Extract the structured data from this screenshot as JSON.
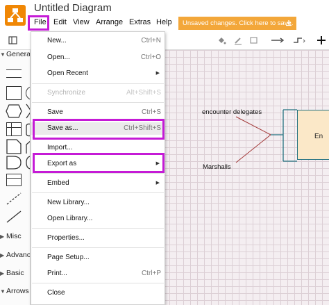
{
  "header": {
    "title": "Untitled Diagram",
    "menu": [
      "File",
      "Edit",
      "View",
      "Arrange",
      "Extras",
      "Help"
    ],
    "unsaved_label": "Unsaved changes. Click here to save."
  },
  "toolbar": {
    "icons": [
      "view-toggle-icon",
      "fill-color-icon",
      "line-color-icon",
      "shadow-icon",
      "connection-icon",
      "waypoints-icon",
      "insert-icon"
    ]
  },
  "sidebar": {
    "sections": [
      "General",
      "Misc",
      "Advanced",
      "Basic",
      "Arrows"
    ]
  },
  "file_menu": {
    "items": [
      {
        "label": "New...",
        "shortcut": "Ctrl+N"
      },
      {
        "label": "Open...",
        "shortcut": "Ctrl+O"
      },
      {
        "label": "Open Recent",
        "submenu": true
      },
      {
        "label": "Synchronize",
        "shortcut": "Alt+Shift+S",
        "disabled": true
      },
      {
        "label": "Save",
        "shortcut": "Ctrl+S"
      },
      {
        "label": "Save as...",
        "shortcut": "Ctrl+Shift+S",
        "highlighted": true
      },
      {
        "label": "Import..."
      },
      {
        "label": "Export as",
        "submenu": true,
        "highlighted": true
      },
      {
        "label": "Embed",
        "submenu": true
      },
      {
        "label": "New Library..."
      },
      {
        "label": "Open Library..."
      },
      {
        "label": "Properties..."
      },
      {
        "label": "Page Setup..."
      },
      {
        "label": "Print...",
        "shortcut": "Ctrl+P"
      },
      {
        "label": "Close"
      }
    ]
  },
  "canvas": {
    "labels": {
      "encounter_delegates": "encounter delegates",
      "marshalls": "Marshalls",
      "entity_partial": "En"
    }
  },
  "colors": {
    "highlight": "#c51bd6",
    "unsaved_bg": "#f3a73a",
    "logo": "#f08705",
    "entity_fill": "#fbe8c8",
    "bracket": "#23717f",
    "connector": "#a33a3a"
  }
}
